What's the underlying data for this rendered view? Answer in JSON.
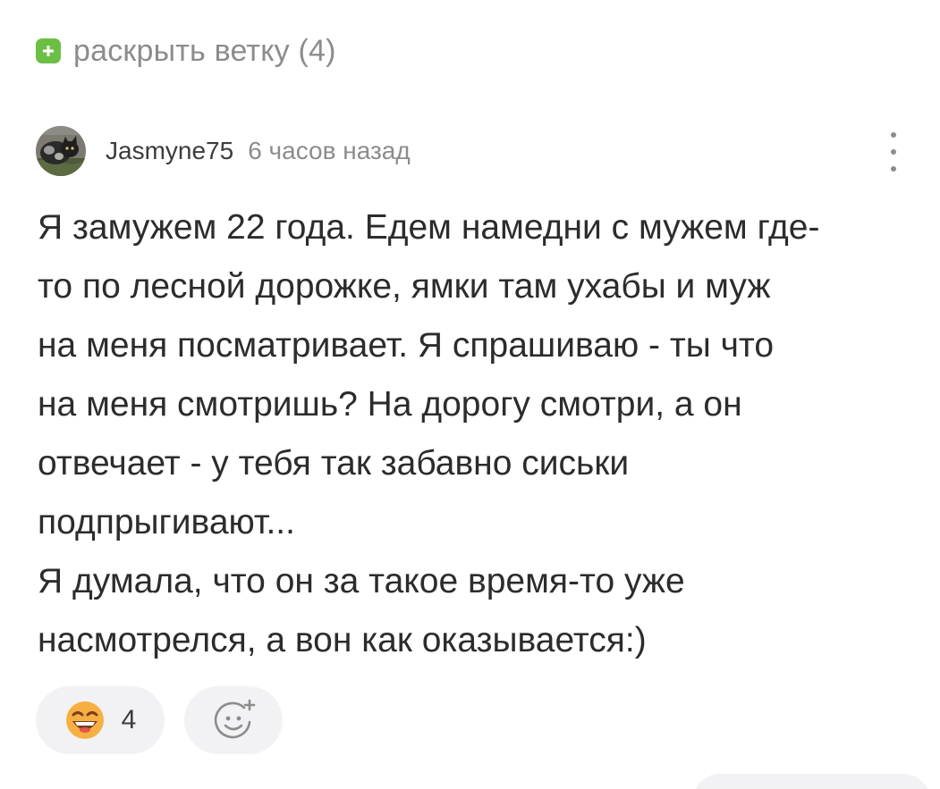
{
  "thread": {
    "expand_label": "раскрыть ветку (4)",
    "expand_icon": "plus-icon"
  },
  "comment": {
    "author": "Jasmyne75",
    "time_ago": "6 часов назад",
    "avatar_icon": "cat-avatar",
    "menu_icon": "more-vertical-icon",
    "lines": [
      "Я замужем 22 года. Едем намедни с мужем где-",
      "то по лесной дорожке, ямки там ухабы и муж",
      "на меня посматривает. Я спрашиваю - ты что",
      "на меня смотришь? На дорогу смотри, а он",
      "отвечает - у тебя так забавно сиськи",
      "подпрыгивают...",
      "Я думала, что он за такое время-то уже",
      "насмотрелся, а вон как оказывается:)"
    ]
  },
  "reactions": {
    "items": [
      {
        "icon": "grinning-emoji-icon",
        "count": "4"
      }
    ],
    "add_icon": "add-reaction-icon"
  },
  "colors": {
    "accent_green": "#6cbf45",
    "text_primary": "#2c2c2c",
    "text_secondary": "#8c8c8c",
    "pill_bg": "#f2f2f4",
    "emoji_face": "#f6b042",
    "emoji_mouth": "#7a3d1e"
  }
}
